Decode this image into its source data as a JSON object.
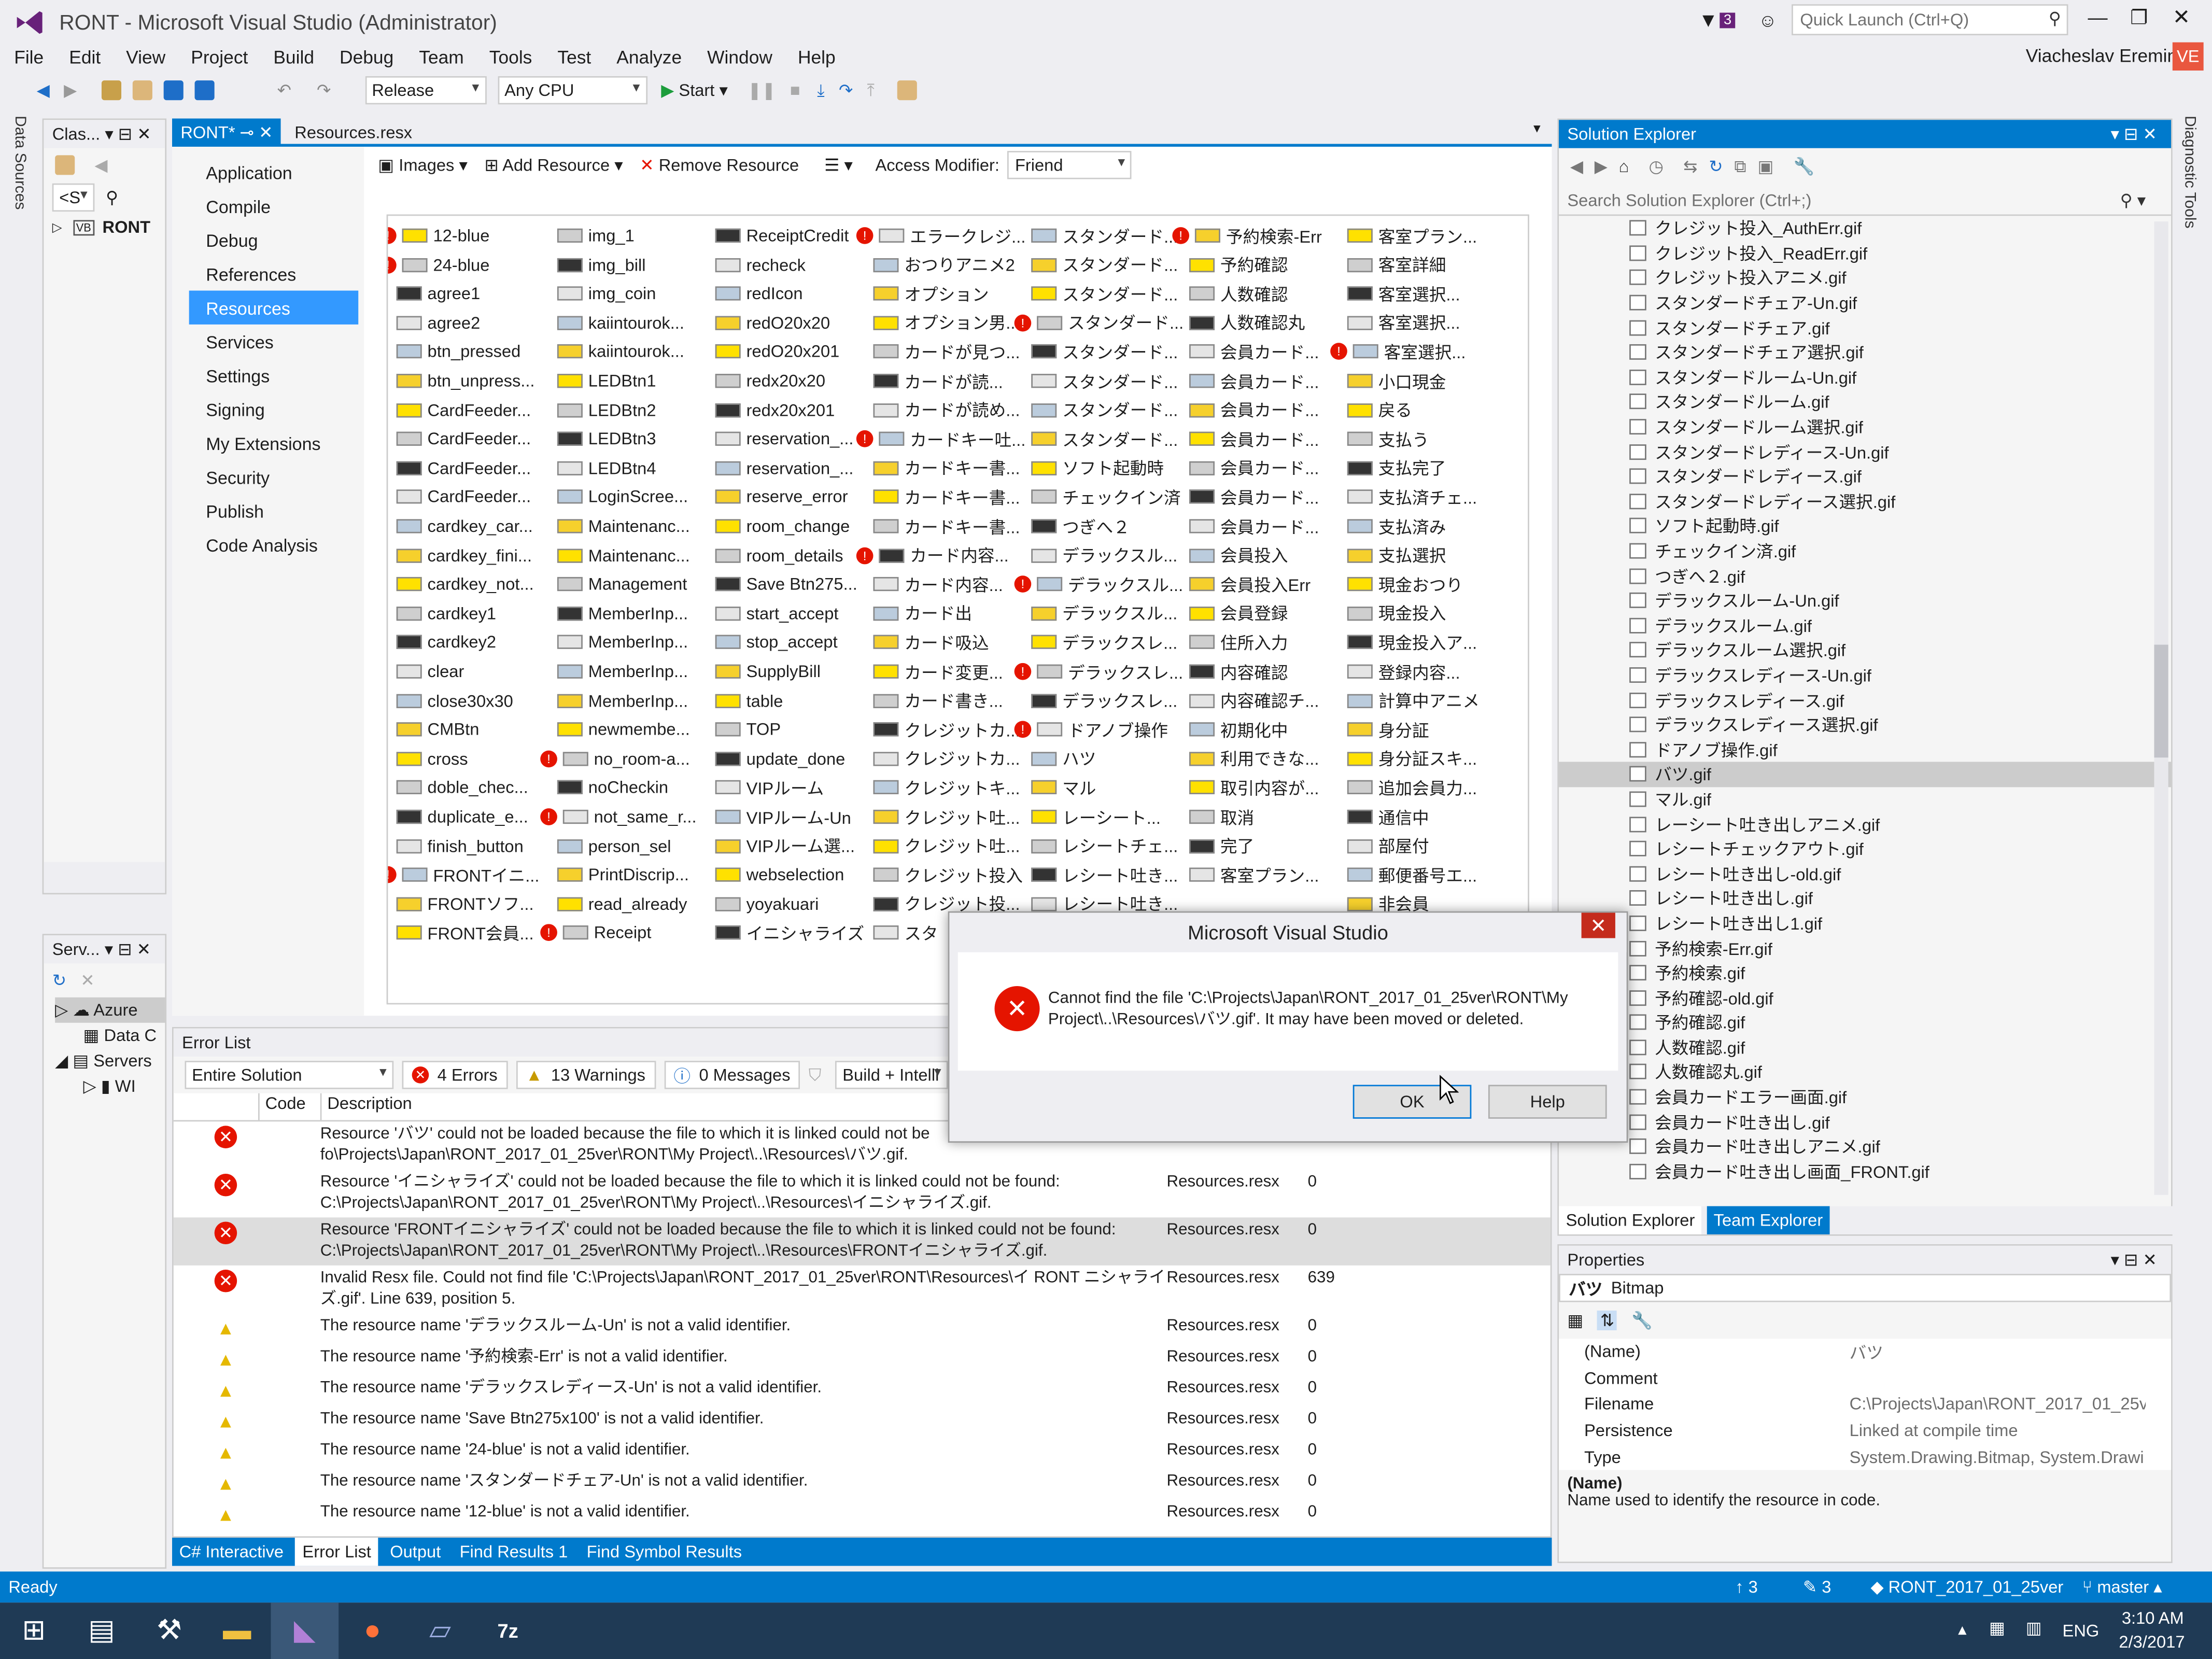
{
  "window": {
    "title": "RONT - Microsoft Visual Studio (Administrator)",
    "notification_count": "3",
    "quick_launch_placeholder": "Quick Launch (Ctrl+Q)",
    "user": "Viacheslav Eremin",
    "user_initials": "VE"
  },
  "menu": [
    "File",
    "Edit",
    "View",
    "Project",
    "Build",
    "Debug",
    "Team",
    "Tools",
    "Test",
    "Analyze",
    "Window",
    "Help"
  ],
  "toolbar": {
    "configuration": "Release",
    "platform": "Any CPU",
    "start_label": "Start"
  },
  "left_strip": {
    "data_sources": "Data Sources"
  },
  "class_view": {
    "title": "Clas...",
    "scope": "<S",
    "root_item": "RONT"
  },
  "server_view": {
    "title": "Serv...",
    "items": [
      "Azure",
      "Data C",
      "Servers",
      "WI"
    ]
  },
  "doc_tabs": {
    "active": "RONT*",
    "other": "Resources.resx"
  },
  "designer_nav": [
    "Application",
    "Compile",
    "Debug",
    "References",
    "Resources",
    "Services",
    "Settings",
    "Signing",
    "My Extensions",
    "Security",
    "Publish",
    "Code Analysis"
  ],
  "designer_nav_selected": "Resources",
  "resource_toolbar": {
    "images": "Images",
    "add": "Add Resource",
    "remove": "Remove Resource",
    "access_label": "Access Modifier:",
    "access_value": "Friend"
  },
  "resource_columns": [
    [
      "12-blue",
      "24-blue",
      "agree1",
      "agree2",
      "btn_pressed",
      "btn_unpress...",
      "CardFeeder...",
      "CardFeeder...",
      "CardFeeder...",
      "CardFeeder...",
      "cardkey_car...",
      "cardkey_fini...",
      "cardkey_not...",
      "cardkey1",
      "cardkey2",
      "clear",
      "close30x30",
      "CMBtn",
      "cross",
      "doble_chec...",
      "duplicate_e...",
      "finish_button",
      "FRONTイニ...",
      "FRONTソフ...",
      "FRONT会員..."
    ],
    [
      "img_1",
      "img_bill",
      "img_coin",
      "kaiintourok...",
      "kaiintourok...",
      "LEDBtn1",
      "LEDBtn2",
      "LEDBtn3",
      "LEDBtn4",
      "LoginScree...",
      "Maintenanc...",
      "Maintenanc...",
      "Management",
      "MemberInp...",
      "MemberInp...",
      "MemberInp...",
      "MemberInp...",
      "newmembe...",
      "no_room-a...",
      "noCheckin",
      "not_same_r...",
      "person_sel",
      "PrintDiscrip...",
      "read_already",
      "Receipt"
    ],
    [
      "ReceiptCredit",
      "recheck",
      "redIcon",
      "redO20x20",
      "redO20x201",
      "redx20x20",
      "redx20x201",
      "reservation_...",
      "reservation_...",
      "reserve_error",
      "room_change",
      "room_details",
      "Save Btn275...",
      "start_accept",
      "stop_accept",
      "SupplyBill",
      "table",
      "TOP",
      "update_done",
      "VIPルーム",
      "VIPルーム-Un",
      "VIPルーム選...",
      "webselection",
      "yoyakuari",
      "イニシャライズ"
    ],
    [
      "エラークレジ...",
      "おつりアニメ2",
      "オプション",
      "オプション男...",
      "カードが見つ...",
      "カードが読...",
      "カードが読め...",
      "カードキー吐...",
      "カードキー書...",
      "カードキー書...",
      "カードキー書...",
      "カード内容...",
      "カード内容...",
      "カード出",
      "カード吸込",
      "カード変更...",
      "カード書き...",
      "クレジットカ...",
      "クレジットカ...",
      "クレジットキ...",
      "クレジット吐...",
      "クレジット吐...",
      "クレジット投入",
      "クレジット投...",
      "スタ"
    ],
    [
      "スタンダード...",
      "スタンダード...",
      "スタンダード...",
      "スタンダード...",
      "スタンダード...",
      "スタンダード...",
      "スタンダード...",
      "スタンダード...",
      "ソフト起動時",
      "チェックイン済",
      "つぎへ２",
      "デラックスル...",
      "デラックスル...",
      "デラックスル...",
      "デラックスレ...",
      "デラックスレ...",
      "デラックスレ...",
      "ドアノブ操作",
      "ハツ",
      "マル",
      "レーシート...",
      "レシートチェ...",
      "レシート吐き...",
      "レシート吐き..."
    ],
    [
      "予約検索-Err",
      "予約確認",
      "人数確認",
      "人数確認丸",
      "会員カード...",
      "会員カード...",
      "会員カード...",
      "会員カード...",
      "会員カード...",
      "会員カード...",
      "会員カード...",
      "会員投入",
      "会員投入Err",
      "会員登録",
      "住所入力",
      "内容確認",
      "内容確認チ...",
      "初期化中",
      "利用できな...",
      "取引内容が...",
      "取消",
      "完了",
      "客室プラン..."
    ],
    [
      "客室プラン...",
      "客室詳細",
      "客室選択...",
      "客室選択...",
      "客室選択...",
      "小口現金",
      "戻る",
      "支払う",
      "支払完了",
      "支払済チェ...",
      "支払済み",
      "支払選択",
      "現金おつり",
      "現金投入",
      "現金投入ア...",
      "登録内容...",
      "計算中アニメ",
      "身分証",
      "身分証スキ...",
      "追加会員力...",
      "通信中",
      "部屋付",
      "郵便番号エ...",
      "非会員"
    ]
  ],
  "error_list": {
    "title": "Error List",
    "scope": "Entire Solution",
    "errors_chip": "4 Errors",
    "warnings_chip": "13 Warnings",
    "messages_chip": "0 Messages",
    "build_filter": "Build + Intelli",
    "col_code": "Code",
    "col_desc": "Description",
    "rows": [
      {
        "type": "error",
        "desc": "Resource 'バツ' could not be loaded because the file to which it is linked could not be fo\\Projects\\Japan\\RONT_2017_01_25ver\\RONT\\My Project\\..\\Resources\\バツ.gif.",
        "file": "",
        "line": ""
      },
      {
        "type": "error",
        "desc": "Resource 'イニシャライズ' could not be loaded because the file to which it is linked could not be found: C:\\Projects\\Japan\\RONT_2017_01_25ver\\RONT\\My Project\\..\\Resources\\イニシャライズ.gif.",
        "file": "Resources.resx",
        "line": "0"
      },
      {
        "type": "error",
        "desc": "Resource 'FRONTイニシャライズ' could not be loaded because the file to which it is linked could not be found: C:\\Projects\\Japan\\RONT_2017_01_25ver\\RONT\\My Project\\..\\Resources\\FRONTイニシャライズ.gif.",
        "file": "Resources.resx",
        "line": "0"
      },
      {
        "type": "error",
        "desc": "Invalid Resx file. Could not find file 'C:\\Projects\\Japan\\RONT_2017_01_25ver\\RONT\\Resources\\イ RONT ニシャライズ.gif'. Line 639, position 5.",
        "file": "Resources.resx",
        "line": "639"
      },
      {
        "type": "warning",
        "desc": "The resource name 'デラックスルーム-Un' is not a valid identifier.",
        "file": "Resources.resx",
        "line": "0"
      },
      {
        "type": "warning",
        "desc": "The resource name '予約検索-Err' is not a valid identifier.",
        "file": "Resources.resx",
        "line": "0"
      },
      {
        "type": "warning",
        "desc": "The resource name 'デラックスレディース-Un' is not a valid identifier.",
        "file": "Resources.resx",
        "line": "0"
      },
      {
        "type": "warning",
        "desc": "The resource name 'Save Btn275x100' is not a valid identifier.",
        "file": "Resources.resx",
        "line": "0"
      },
      {
        "type": "warning",
        "desc": "The resource name '24-blue' is not a valid identifier.",
        "file": "Resources.resx",
        "line": "0"
      },
      {
        "type": "warning",
        "desc": "The resource name 'スタンダードチェア-Un' is not a valid identifier.",
        "file": "Resources.resx",
        "line": "0"
      },
      {
        "type": "warning",
        "desc": "The resource name '12-blue' is not a valid identifier.",
        "file": "Resources.resx",
        "line": "0"
      }
    ]
  },
  "bottom_tabs": [
    "C# Interactive",
    "Error List",
    "Output",
    "Find Results 1",
    "Find Symbol Results"
  ],
  "bottom_tab_active": "Error List",
  "solution_explorer": {
    "title": "Solution Explorer",
    "search_placeholder": "Search Solution Explorer (Ctrl+;)",
    "items": [
      "クレジット投入_AuthErr.gif",
      "クレジット投入_ReadErr.gif",
      "クレジット投入アニメ.gif",
      "スタンダードチェア-Un.gif",
      "スタンダードチェア.gif",
      "スタンダードチェア選択.gif",
      "スタンダードルーム-Un.gif",
      "スタンダードルーム.gif",
      "スタンダードルーム選択.gif",
      "スタンダードレディース-Un.gif",
      "スタンダードレディース.gif",
      "スタンダードレディース選択.gif",
      "ソフト起動時.gif",
      "チェックイン済.gif",
      "つぎへ２.gif",
      "デラックスルーム-Un.gif",
      "デラックスルーム.gif",
      "デラックスルーム選択.gif",
      "デラックスレディース-Un.gif",
      "デラックスレディース.gif",
      "デラックスレディース選択.gif",
      "ドアノブ操作.gif",
      "バツ.gif",
      "マル.gif",
      "レーシート吐き出しアニメ.gif",
      "レシートチェックアウト.gif",
      "レシート吐き出し-old.gif",
      "レシート吐き出し.gif",
      "レシート吐き出し1.gif",
      "予約検索-Err.gif",
      "予約検索.gif",
      "予約確認-old.gif",
      "予約確認.gif",
      "人数確認.gif",
      "人数確認丸.gif",
      "会員カードエラー画面.gif",
      "会員カード吐き出し.gif",
      "会員カード吐き出しアニメ.gif",
      "会員カード吐き出し画面_FRONT.gif"
    ],
    "selected": "バツ.gif",
    "tab_active": "Solution Explorer",
    "tab_other": "Team Explorer"
  },
  "properties": {
    "title": "Properties",
    "object_name": "バツ",
    "object_type": "Bitmap",
    "rows": [
      {
        "k": "(Name)",
        "v": "バツ"
      },
      {
        "k": "Comment",
        "v": ""
      },
      {
        "k": "Filename",
        "v": "C:\\Projects\\Japan\\RONT_2017_01_25ve"
      },
      {
        "k": "Persistence",
        "v": "Linked at compile time"
      },
      {
        "k": "Type",
        "v": "System.Drawing.Bitmap, System.Drawi"
      }
    ],
    "desc_title": "(Name)",
    "desc_text": "Name used to identify the resource in code."
  },
  "right_strip": {
    "diagnostic": "Diagnostic Tools"
  },
  "status": {
    "text": "Ready",
    "up": "3",
    "pencil": "3",
    "repo": "RONT_2017_01_25ver",
    "branch": "master"
  },
  "taskbar": {
    "lang": "ENG",
    "time": "3:10 AM",
    "date": "2/3/2017"
  },
  "dialog": {
    "title": "Microsoft Visual Studio",
    "message_line1": "Cannot find the file 'C:\\Projects\\Japan\\RONT_2017_01_25ver\\RONT\\My",
    "message_line2": "Project\\..\\Resources\\バツ.gif'.  It may have been moved or deleted.",
    "ok": "OK",
    "help": "Help"
  },
  "colors": {
    "accent": "#007acc",
    "error": "#e51400",
    "warning": "#ffcc00",
    "user_badge": "#e9573f"
  }
}
